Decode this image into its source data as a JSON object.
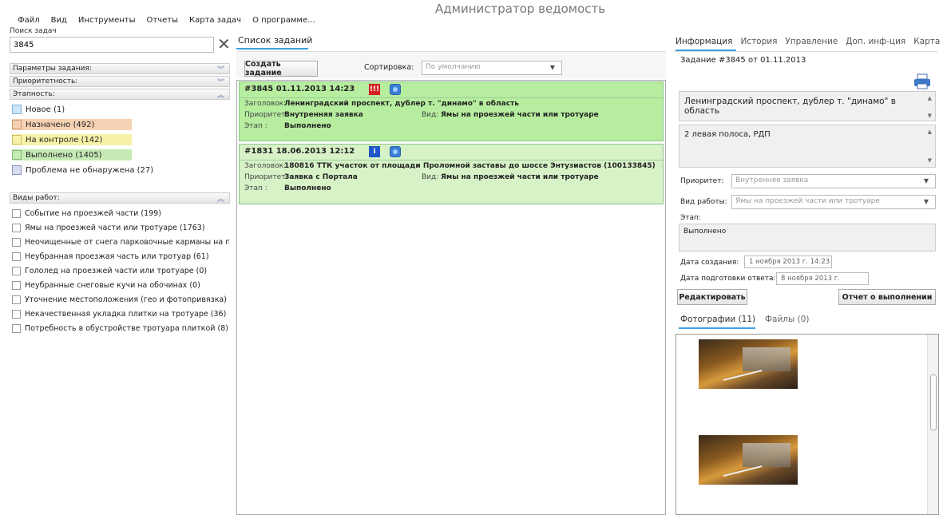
{
  "window": {
    "title": "Администратор ведомость"
  },
  "menu": [
    "Файл",
    "Вид",
    "Инструменты",
    "Отчеты",
    "Карта задач",
    "О программе..."
  ],
  "search": {
    "label": "Поиск задач",
    "value": "3845"
  },
  "filters": {
    "params_label": "Параметры задания:",
    "priority_label": "Приоритетность:",
    "stage_label": "Этапность:",
    "statuses": [
      {
        "label": "Новое (1)",
        "color": "#cfe6f6"
      },
      {
        "label": "Назначено (492)",
        "color": "#f6d2b4"
      },
      {
        "label": "На контроле (142)",
        "color": "#f7f2a8"
      },
      {
        "label": "Выполнено (1405)",
        "color": "#c5eab4"
      },
      {
        "label": "Проблема не обнаружена (27)",
        "color": "#d6dcef"
      }
    ],
    "work_types_label": "Виды работ:",
    "work_types": [
      "Событие на проезжей части (199)",
      "Ямы на проезжей части или тротуаре (1763)",
      "Неочищенные от снега парковочные карманы на проезжей части",
      "Неубранная проезжая часть или тротуар (61)",
      "Гололед на проезжей части или тротуаре (0)",
      "Неубранные снеговые кучи на обочинах (0)",
      "Уточнение местоположения (гео и фотопривязка) (0)",
      "Некачественная укладка плитки на тротуаре (36)",
      "Потребность в обустройстве тротуара плиткой (8)"
    ]
  },
  "task_list": {
    "title": "Список заданий",
    "create_button": "Создать задание",
    "sort_label": "Сортировка:",
    "sort_value": "По умолчанию",
    "tasks": [
      {
        "head": "#3845  01.11.2013  14:23",
        "flag_glyph": "!!!",
        "flag_color": "#d42020",
        "title_key": "Заголовок:",
        "title": "Ленинградский проспект, дублер т. \"динамо\" в область",
        "priority_key": "Приоритет:",
        "priority": "Внутренняя заявка",
        "type_key": "Вид:",
        "type": "Ямы на проезжей части или тротуаре",
        "stage_key": "Этап :",
        "stage": "Выполнено"
      },
      {
        "head": "#1831  18.06.2013  12:12",
        "flag_glyph": "i",
        "flag_color": "#1f56c8",
        "title_key": "Заголовок:",
        "title": "180816  ТТК участок от площади Проломной заставы до шоссе Энтузиастов (100133845)",
        "priority_key": "Приоритет:",
        "priority": "Заявка с Портала",
        "type_key": "Вид:",
        "type": "Ямы на проезжей части или тротуаре",
        "stage_key": "Этап :",
        "stage": "Выполнено"
      }
    ]
  },
  "details": {
    "tabs": [
      "Информация",
      "История",
      "Управление",
      "Доп. инф-ция",
      "Карта"
    ],
    "header": "Задание #3845 от 01.11.2013",
    "title_text": "Ленинградский проспект, дублер т. \"динамо\" в область",
    "comment_text": "2 левая полоса, РДП",
    "priority_label": "Приоритет:",
    "priority_value": "Внутренняя заявка",
    "work_label": "Вид работы:",
    "work_value": "Ямы на проезжей части или тротуаре",
    "stage_label": "Этап:",
    "stage_value": "Выполнено",
    "created_label": "Дата создания:",
    "created_value": "1  ноября  2013 г. 14:23",
    "answer_label": "Дата подготовки ответа:",
    "answer_value": "8  ноября  2013 г.",
    "edit_button": "Редактировать",
    "report_button": "Отчет о выполнении",
    "photos_tab": "Фотографии (11)",
    "files_tab": "Файлы (0)"
  }
}
